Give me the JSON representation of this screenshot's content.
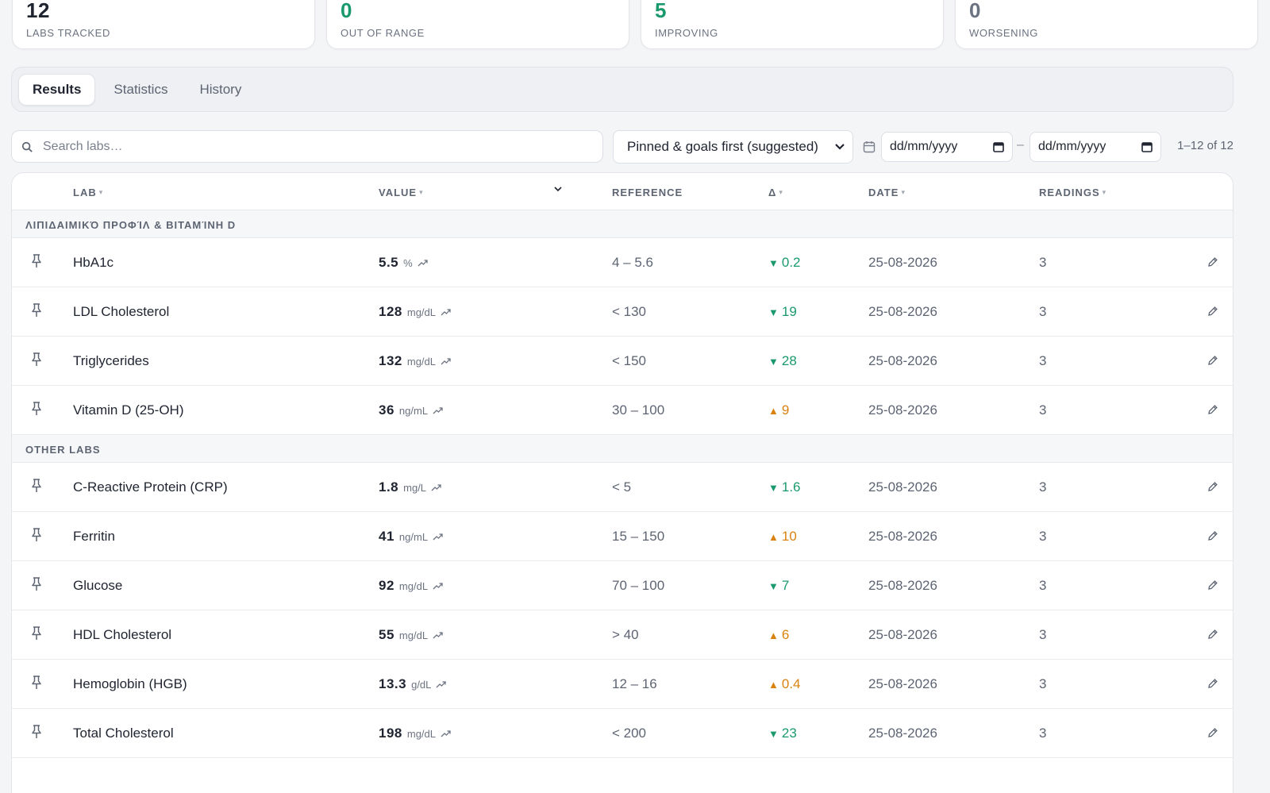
{
  "stats": [
    {
      "value": "12",
      "label": "LABS TRACKED",
      "tone": "dark"
    },
    {
      "value": "0",
      "label": "OUT OF RANGE",
      "tone": "green"
    },
    {
      "value": "5",
      "label": "IMPROVING",
      "tone": "green"
    },
    {
      "value": "0",
      "label": "WORSENING",
      "tone": "gray"
    }
  ],
  "tabs": [
    "Results",
    "Statistics",
    "History"
  ],
  "active_tab": "Results",
  "search": {
    "placeholder": "Search labs…",
    "value": ""
  },
  "sort": {
    "selected": "Pinned & goals first (suggested)"
  },
  "date_from": {
    "placeholder": "dd/mm/yyyy"
  },
  "date_to": {
    "placeholder": "dd/mm/yyyy"
  },
  "date_separator": "–",
  "pager": "1–12 of 12",
  "columns": {
    "lab": "LAB",
    "value": "VALUE",
    "reference": "REFERENCE",
    "delta": "Δ",
    "date": "DATE",
    "readings": "READINGS"
  },
  "groups": [
    {
      "title": "ΛΙΠΙΔΑΙΜΙΚΌ ΠΡΟΦΊΛ & ΒΙΤΑΜΊΝΗ D",
      "rows": [
        {
          "lab": "HbA1c",
          "value": "5.5",
          "unit": "%",
          "reference": "4 – 5.6",
          "delta": "0.2",
          "dir": "down",
          "date": "25-08-2026",
          "readings": "3"
        },
        {
          "lab": "LDL Cholesterol",
          "value": "128",
          "unit": "mg/dL",
          "reference": "< 130",
          "delta": "19",
          "dir": "down",
          "date": "25-08-2026",
          "readings": "3"
        },
        {
          "lab": "Triglycerides",
          "value": "132",
          "unit": "mg/dL",
          "reference": "< 150",
          "delta": "28",
          "dir": "down",
          "date": "25-08-2026",
          "readings": "3"
        },
        {
          "lab": "Vitamin D (25-OH)",
          "value": "36",
          "unit": "ng/mL",
          "reference": "30 – 100",
          "delta": "9",
          "dir": "up",
          "date": "25-08-2026",
          "readings": "3"
        }
      ]
    },
    {
      "title": "OTHER LABS",
      "rows": [
        {
          "lab": "C-Reactive Protein (CRP)",
          "value": "1.8",
          "unit": "mg/L",
          "reference": "< 5",
          "delta": "1.6",
          "dir": "down",
          "date": "25-08-2026",
          "readings": "3"
        },
        {
          "lab": "Ferritin",
          "value": "41",
          "unit": "ng/mL",
          "reference": "15 – 150",
          "delta": "10",
          "dir": "up",
          "date": "25-08-2026",
          "readings": "3"
        },
        {
          "lab": "Glucose",
          "value": "92",
          "unit": "mg/dL",
          "reference": "70 – 100",
          "delta": "7",
          "dir": "down",
          "date": "25-08-2026",
          "readings": "3"
        },
        {
          "lab": "HDL Cholesterol",
          "value": "55",
          "unit": "mg/dL",
          "reference": "> 40",
          "delta": "6",
          "dir": "up",
          "date": "25-08-2026",
          "readings": "3"
        },
        {
          "lab": "Hemoglobin (HGB)",
          "value": "13.3",
          "unit": "g/dL",
          "reference": "12 – 16",
          "delta": "0.4",
          "dir": "up",
          "date": "25-08-2026",
          "readings": "3"
        },
        {
          "lab": "Total Cholesterol",
          "value": "198",
          "unit": "mg/dL",
          "reference": "< 200",
          "delta": "23",
          "dir": "down",
          "date": "25-08-2026",
          "readings": "3"
        }
      ]
    }
  ],
  "icons": {
    "pin": "pin-icon",
    "trend": "trend-up-icon",
    "edit": "pencil-icon",
    "search": "search-icon",
    "calendar": "calendar-icon"
  },
  "colors": {
    "improving": "#1a9a6c",
    "worsening": "#d9820f"
  }
}
